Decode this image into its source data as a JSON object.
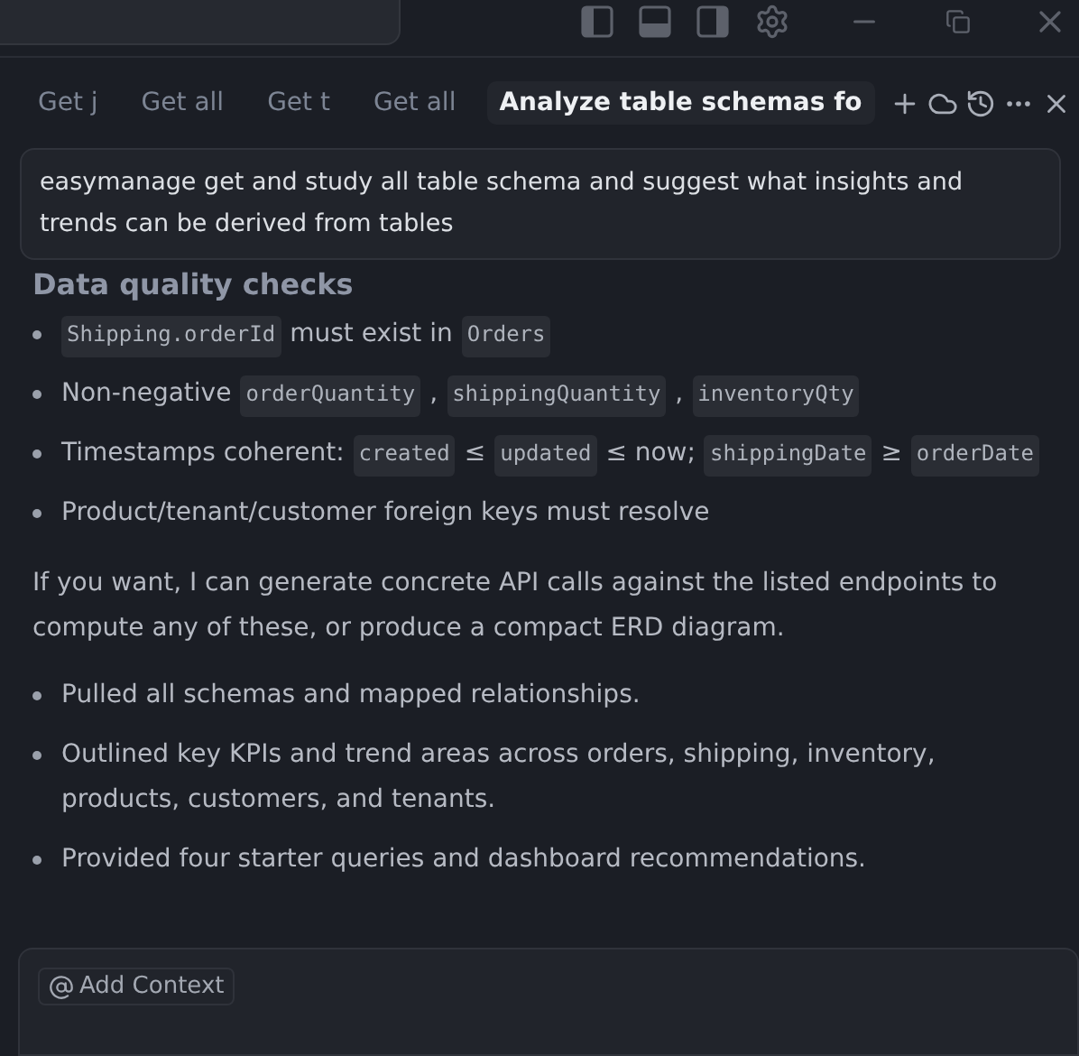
{
  "tabs": [
    {
      "label": "Get j",
      "selected": false
    },
    {
      "label": "Get all",
      "selected": false
    },
    {
      "label": "Get t",
      "selected": false
    },
    {
      "label": "Get all",
      "selected": false
    },
    {
      "label": "Analyze table schemas fo",
      "selected": true
    }
  ],
  "prompt": "easymanage get and study all table schema and suggest what insights and trends can be derived from tables",
  "section_heading": "Data quality checks",
  "checks": [
    [
      {
        "kind": "code",
        "text": "Shipping.orderId"
      },
      {
        "kind": "text",
        "text": "must exist in"
      },
      {
        "kind": "code",
        "text": "Orders"
      }
    ],
    [
      {
        "kind": "text",
        "text": "Non-negative"
      },
      {
        "kind": "code",
        "text": "orderQuantity"
      },
      {
        "kind": "text",
        "text": ","
      },
      {
        "kind": "code",
        "text": "shippingQuantity"
      },
      {
        "kind": "text",
        "text": ","
      },
      {
        "kind": "code",
        "text": "inventoryQty"
      }
    ],
    [
      {
        "kind": "text",
        "text": "Timestamps coherent:"
      },
      {
        "kind": "code",
        "text": "created"
      },
      {
        "kind": "text",
        "text": "≤"
      },
      {
        "kind": "code",
        "text": "updated"
      },
      {
        "kind": "text",
        "text": "≤ now;"
      },
      {
        "kind": "code",
        "text": "shippingDate"
      },
      {
        "kind": "text",
        "text": "≥"
      },
      {
        "kind": "code",
        "text": "orderDate"
      }
    ],
    [
      {
        "kind": "text",
        "text": "Product/tenant/customer foreign keys must resolve"
      }
    ]
  ],
  "paragraph": "If you want, I can generate concrete API calls against the listed endpoints to compute any of these, or produce a compact ERD diagram.",
  "summary": [
    "Pulled all schemas and mapped relationships.",
    "Outlined key KPIs and trend areas across orders, shipping, inventory, products, customers, and tenants.",
    "Provided four starter queries and dashboard recommendations."
  ],
  "composer": {
    "context_button": "Add Context"
  }
}
